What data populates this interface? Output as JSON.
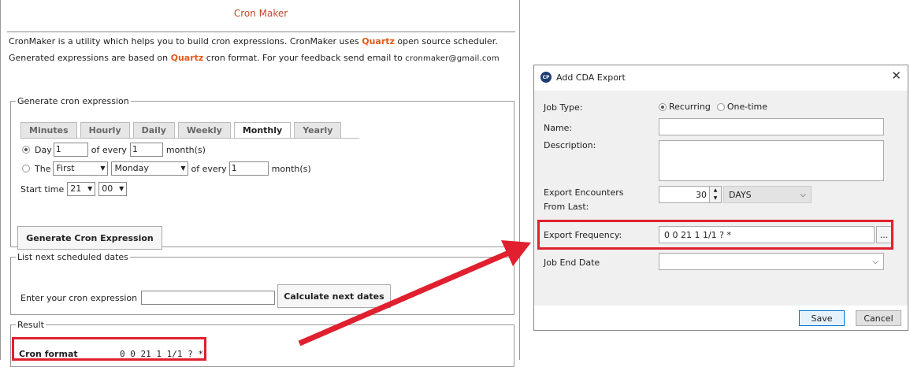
{
  "cronmaker": {
    "title": "Cron Maker",
    "intro_line1_a": "CronMaker is a utility which helps you to build cron expressions. CronMaker uses ",
    "intro_quartz": "Quartz",
    "intro_line1_b": " open source scheduler.",
    "intro_line2_a": "Generated expressions are based on ",
    "intro_line2_b": " cron format. For your feedback send email to ",
    "intro_email": "cronmaker@gmail.com",
    "generate_legend": "Generate cron expression",
    "tabs": [
      {
        "label": "Minutes",
        "active": false
      },
      {
        "label": "Hourly",
        "active": false
      },
      {
        "label": "Daily",
        "active": false
      },
      {
        "label": "Weekly",
        "active": false
      },
      {
        "label": "Monthly",
        "active": true
      },
      {
        "label": "Yearly",
        "active": false
      }
    ],
    "day_label": "Day",
    "day_value": "1",
    "of_every_label": "of every",
    "month_value": "1",
    "months_label": "month(s)",
    "the_label": "The",
    "ordinal_value": "First",
    "weekday_value": "Monday",
    "of_every_label2": "of every",
    "month_value2": "1",
    "months_label2": "month(s)",
    "start_time_label": "Start time",
    "hour_value": "21",
    "minute_value": "00",
    "generate_button": "Generate Cron Expression",
    "list_legend": "List next scheduled dates",
    "enter_label": "Enter your cron expression",
    "cron_input_value": "",
    "calc_button": "Calculate next dates",
    "result_legend": "Result",
    "cron_format_label": "Cron format",
    "cron_format_value": "0 0 21 1 1/1 ? *"
  },
  "dialog": {
    "title": "Add CDA Export",
    "logo_text": "CP",
    "close_glyph": "✕",
    "job_type_label": "Job Type:",
    "recurring_label": "Recurring",
    "onetime_label": "One-time",
    "name_label": "Name:",
    "name_value": "",
    "description_label": "Description:",
    "description_value": "",
    "encounters_label_1": "Export Encounters",
    "encounters_label_2": "From Last:",
    "encounters_value": "30",
    "unit_value": "DAYS",
    "frequency_label": "Export Frequency:",
    "frequency_value": "0 0 21 1 1/1 ? *",
    "browse_label": "...",
    "end_date_label": "Job End Date",
    "end_date_value": "",
    "save_button": "Save",
    "cancel_button": "Cancel"
  },
  "colors": {
    "highlight": "#e0202e",
    "accent": "#c8452a",
    "arrow": "#e0202e"
  }
}
